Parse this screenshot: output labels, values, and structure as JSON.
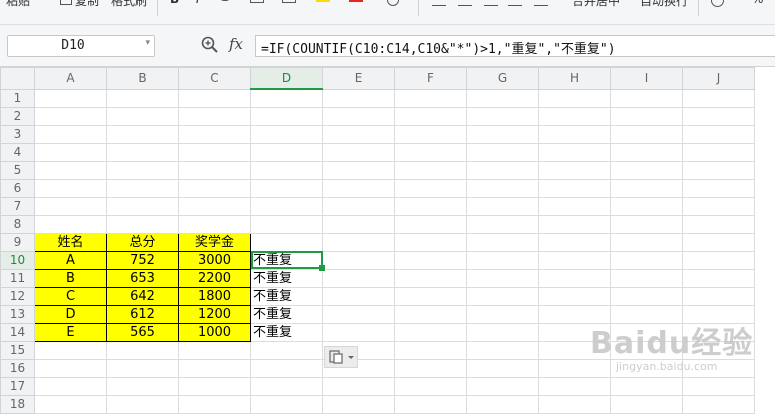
{
  "ribbon": {
    "paste_label": "粘贴",
    "copy_label": "复制",
    "format_painter_label": "格式刷",
    "bold_label": "B",
    "italic_label": "I",
    "merge_center_label": "合并居中",
    "auto_wrap_label": "自动换行",
    "percent_label": "%"
  },
  "formula_bar": {
    "name_box": "D10",
    "fx_label": "fx",
    "formula": "=IF(COUNTIF(C10:C14,C10&\"*\")>1,\"重复\",\"不重复\")"
  },
  "sheet": {
    "columns": [
      "A",
      "B",
      "C",
      "D",
      "E",
      "F",
      "G",
      "H",
      "I",
      "J"
    ],
    "rows": [
      "1",
      "2",
      "3",
      "4",
      "5",
      "6",
      "7",
      "8",
      "9",
      "10",
      "11",
      "12",
      "13",
      "14",
      "15",
      "16",
      "17",
      "18"
    ],
    "active_cell": "D10",
    "cells": {
      "A9": "姓名",
      "B9": "总分",
      "C9": "奖学金",
      "A10": "A",
      "B10": "752",
      "C10": "3000",
      "D10": "不重复",
      "A11": "B",
      "B11": "653",
      "C11": "2200",
      "D11": "不重复",
      "A12": "C",
      "B12": "642",
      "C12": "1800",
      "D12": "不重复",
      "A13": "D",
      "B13": "612",
      "C13": "1200",
      "D13": "不重复",
      "A14": "E",
      "B14": "565",
      "C14": "1000",
      "D14": "不重复"
    }
  },
  "colors": {
    "highlight": "#ffff00",
    "selection": "#1f9a45",
    "header_bg": "#f1f2f4"
  },
  "watermark": {
    "brand": "Baidu经验",
    "url": "jingyan.baidu.com"
  }
}
